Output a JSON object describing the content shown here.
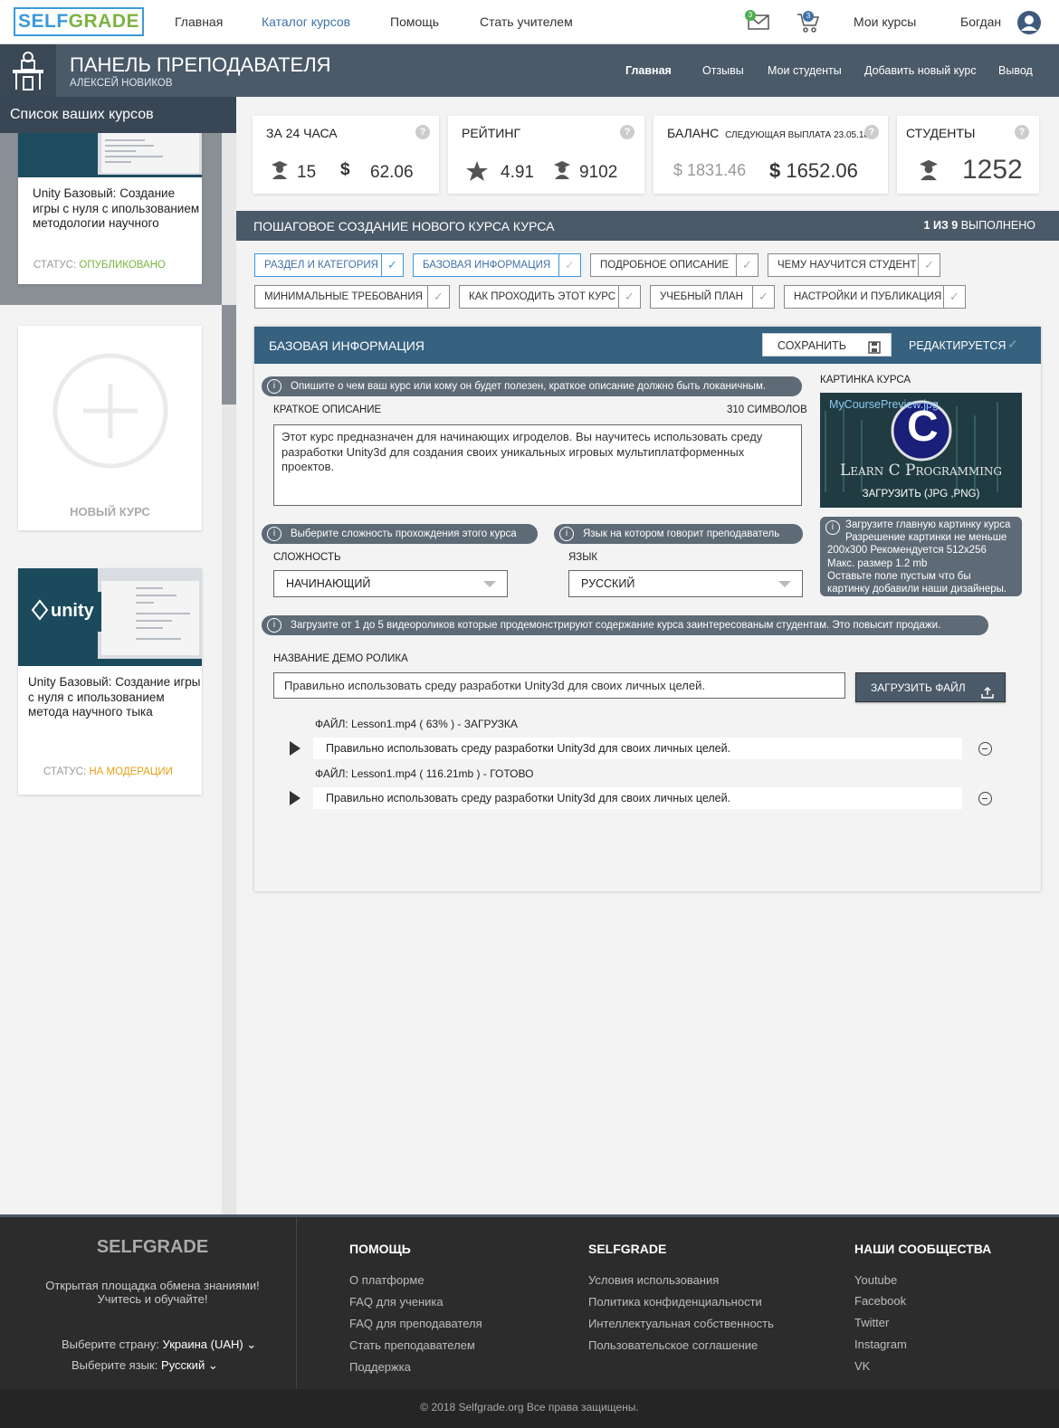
{
  "topbar": {
    "logo_a": "SELF",
    "logo_b": "GRADE",
    "nav": [
      "Главная",
      "Каталог курсов",
      "Помощь",
      "Стать учителем"
    ],
    "mail_badge": "3",
    "cart_badge": "3",
    "my_courses": "Мои курсы",
    "user": "Богдан"
  },
  "panel": {
    "title": "ПАНЕЛЬ ПРЕПОДАВАТЕЛЯ",
    "subtitle": "АЛЕКСЕЙ НОВИКОВ",
    "nav": [
      "Главная",
      "Отзывы",
      "Мои студенты",
      "Добавить новый курс",
      "Вывод"
    ]
  },
  "sidebar": {
    "title": "Список ваших курсов",
    "course1": {
      "title": "Unity Базовый: Создание игры с нуля с ипользованием методологии научного",
      "status_label": "СТАТУС:",
      "status": "ОПУБЛИКОВАНО"
    },
    "new_course": "НОВЫЙ КУРС",
    "course2": {
      "title": "Unity Базовый: Создание игры с нуля с ипользованием метода научного тыка",
      "status_label": "СТАТУС:",
      "status": "НА МОДЕРАЦИИ",
      "logo": "unity"
    }
  },
  "stats": {
    "day": {
      "title": "ЗА 24 ЧАСА",
      "students": "15",
      "money": "62.06"
    },
    "rating": {
      "title": "РЕЙТИНГ",
      "score": "4.91",
      "count": "9102"
    },
    "balance": {
      "title": "БАЛАНС",
      "note": "СЛЕДУЮЩАЯ ВЫПЛАТА 23.05.18",
      "pending": "1831.46",
      "available": "1652.06"
    },
    "students": {
      "title": "СТУДЕНТЫ",
      "count": "1252"
    },
    "help": "?",
    "currency": "$"
  },
  "steps": {
    "title": "ПОШАГОВОЕ СОЗДАНИЕ НОВОГО КУРСА КУРСА",
    "progress_bold": "1 ИЗ 9",
    "progress_text": "ВЫПОЛНЕНО",
    "items": [
      "РАЗДЕЛ И КАТЕГОРИЯ",
      "БАЗОВАЯ ИНФОРМАЦИЯ",
      "ПОДРОБНОЕ ОПИСАНИЕ",
      "ЧЕМУ НАУЧИТСЯ СТУДЕНТ",
      "МИНИМАЛЬНЫЕ ТРЕБОВАНИЯ",
      "КАК ПРОХОДИТЬ ЭТОТ КУРС",
      "УЧЕБНЫЙ ПЛАН",
      "НАСТРОЙКИ И ПУБЛИКАЦИЯ"
    ]
  },
  "form": {
    "title": "БАЗОВАЯ ИНФОРМАЦИЯ",
    "save": "СОХРАНИТЬ",
    "state": "РЕДАКТИРУЕТСЯ",
    "hint_desc": "Опишите о чем ваш курс или кому он будет полезен, краткое описание должно быть локаничным.",
    "desc_label": "КРАТКОЕ ОПИСАНИЕ",
    "desc_count": "310 СИМВОЛОВ",
    "desc_value": "Этот курс предназначен для начинающих игроделов. Вы научитесь использовать среду разработки  Unity3d для создания своих уникальных игровых мультиплатформенных проектов.",
    "image_label": "КАРТИНКА КУРСА",
    "image_file": "MyCoursePreview.jpg",
    "image_caption": "Learn C Programming",
    "image_letter": "C",
    "image_upload": "ЗАГРУЗИТЬ (JPG ,PNG)",
    "image_hint": [
      "Загрузите главную картинку курса",
      "Разрешение картинки не меньше",
      "200x300 Рекомендуется 512x256",
      "Макс. размер 1.2 mb",
      "Оставьте поле пустым что бы",
      "картинку добавили наши дизайнеры."
    ],
    "hint_level": "Выберите сложность прохождения этого курса",
    "hint_lang": "Язык на котором говорит преподаватель",
    "level_label": "СЛОЖНОСТЬ",
    "level_value": "НАЧИНАЮЩИЙ",
    "lang_label": "ЯЗЫК",
    "lang_value": "РУССКИЙ",
    "hint_video": "Загрузите от 1 до 5 видеороликов которые продемонстрируют содержание курса заинтересованым студентам. Это повысит продажи.",
    "demo_label": "НАЗВАНИЕ ДЕМО РОЛИКА",
    "demo_value": "Правильно использовать среду разработки Unity3d для своих личных целей.",
    "upload_btn": "ЗАГРУЗИТЬ ФАЙЛ",
    "files": [
      {
        "label": "ФАЙЛ: Lesson1.mp4 ( 63% ) - ЗАГРУЗКА",
        "title": "Правильно использовать среду разработки Unity3d для своих личных целей."
      },
      {
        "label": "ФАЙЛ: Lesson1.mp4 ( 116.21mb ) - ГОТОВО",
        "title": "Правильно использовать среду разработки Unity3d для своих личных целей."
      }
    ]
  },
  "footer": {
    "brand": "SELFGRADE",
    "tagline1": "Открытая площадка обмена знаниями!",
    "tagline2": "Учитесь и обучайте!",
    "country_label": "Выберите страну:",
    "country": "Украина (UAH)",
    "lang_label": "Выберите язык:",
    "lang": "Русский",
    "help_title": "ПОМОЩЬ",
    "help": [
      "О платформе",
      "FAQ для ученика",
      "FAQ для преподавателя",
      "Стать преподавателем",
      "Поддержка"
    ],
    "sg_title": "SELFGRADE",
    "sg": [
      "Условия использования",
      "Политика конфиденциальности",
      "Интеллектуальная собственность",
      "Пользовательское соглашение"
    ],
    "comm_title": "НАШИ СООБЩЕСТВА",
    "comm": [
      "Youtube",
      "Facebook",
      "Twitter",
      "Instagram",
      "VK"
    ],
    "copyright": "© 2018 Selfgrade.org Все права защищены."
  },
  "colors": {
    "accent": "#3a9ad9",
    "brand_green": "#7cb342",
    "header": "#4b5a69",
    "published": "#7cb342",
    "moderation": "#e6a117"
  }
}
